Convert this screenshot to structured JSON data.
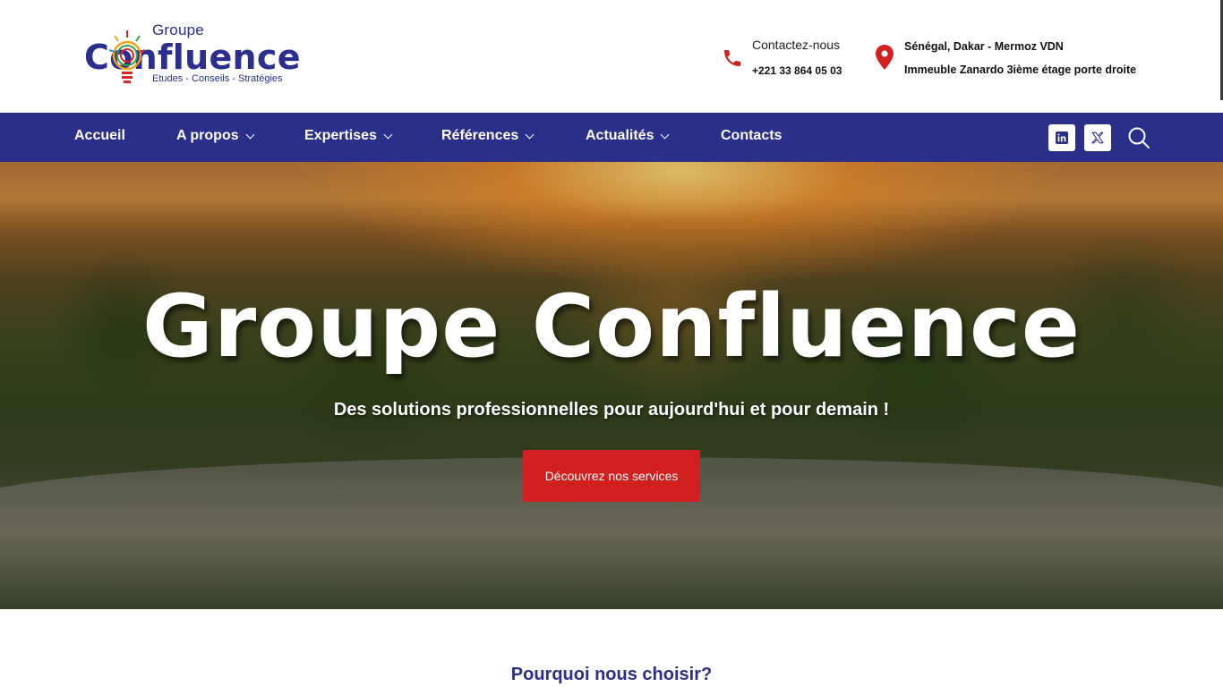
{
  "logo": {
    "top_text": "Groupe",
    "main_text": "Confluence",
    "tagline": "Etudes - Conseils - Stratégies"
  },
  "contact": {
    "title": "Contactez-nous",
    "phone": "+221 33 864 05 03"
  },
  "address": {
    "line1": "Sénégal, Dakar - Mermoz VDN",
    "line2": "Immeuble Zanardo 3ième étage porte droite"
  },
  "nav": {
    "items": [
      {
        "label": "Accueil",
        "has_dropdown": false
      },
      {
        "label": "A propos",
        "has_dropdown": true
      },
      {
        "label": "Expertises",
        "has_dropdown": true
      },
      {
        "label": "Références",
        "has_dropdown": true
      },
      {
        "label": "Actualités",
        "has_dropdown": true
      },
      {
        "label": "Contacts",
        "has_dropdown": false
      }
    ],
    "social": [
      "linkedin-icon",
      "x-twitter-icon"
    ],
    "search_icon": "search-icon"
  },
  "hero": {
    "title": "Groupe Confluence",
    "subtitle": "Des solutions professionnelles pour aujourd'hui et pour demain !",
    "cta": "Découvrez nos services"
  },
  "section": {
    "why_title": "Pourquoi nous choisir?"
  },
  "colors": {
    "brand_blue": "#2b2f8a",
    "accent_red": "#d21f1f"
  }
}
